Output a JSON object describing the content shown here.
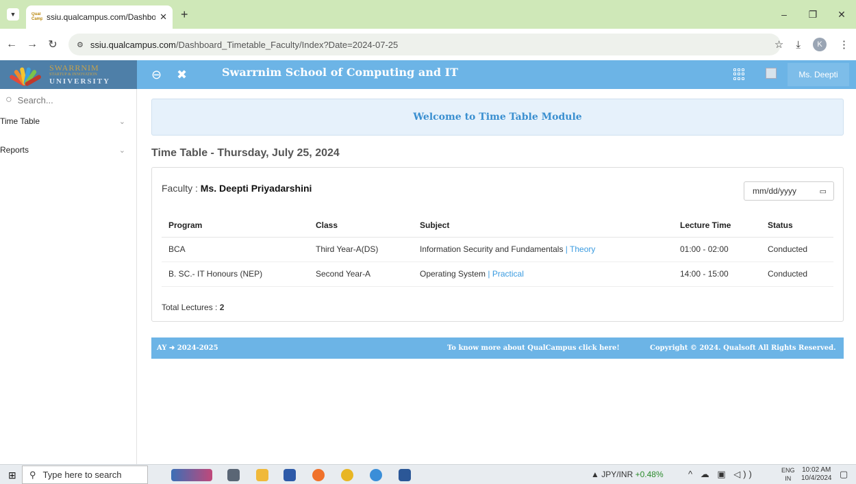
{
  "browser": {
    "tab_title": "ssiu.qualcampus.com/Dashboar",
    "favicon_text": "Qual\nCampus",
    "url_domain": "ssiu.qualcampus.com",
    "url_path": "/Dashboard_Timetable_Faculty/Index?Date=2024-07-25",
    "profile_initial": "K"
  },
  "header": {
    "logo_line1": "SWARRNIM",
    "logo_line2": "STARTUP & INNOVATION",
    "logo_line3": "UNIVERSITY",
    "title": "Swarrnim School of Computing and IT",
    "user_name": "Ms. Deepti"
  },
  "sidebar": {
    "search_placeholder": "Search...",
    "items": [
      {
        "label": "Time Table"
      },
      {
        "label": "Reports"
      }
    ]
  },
  "main": {
    "welcome": "Welcome to Time Table Module",
    "heading": "Time Table - Thursday, July 25, 2024",
    "faculty_label": "Faculty : ",
    "faculty_name": "Ms. Deepti Priyadarshini",
    "date_placeholder": "mm/dd/yyyy",
    "columns": [
      "Program",
      "Class",
      "Subject",
      "Lecture Time",
      "Status"
    ],
    "rows": [
      {
        "program": "BCA",
        "class": "Third Year-A(DS)",
        "subject": "Information Security and Fundamentals",
        "subject_type": "| Theory",
        "time": "01:00 - 02:00",
        "status": "Conducted"
      },
      {
        "program": "B. SC.- IT Honours (NEP)",
        "class": "Second Year-A",
        "subject": "Operating System",
        "subject_type": "| Practical",
        "time": "14:00 - 15:00",
        "status": "Conducted"
      }
    ],
    "total_label": "Total Lectures : ",
    "total_value": "2"
  },
  "footer": {
    "ay": "AY ➜ 2024-2025",
    "more": "To know more about QualCampus click here!",
    "copyright": "Copyright © 2024. Qualsoft All Rights Reserved."
  },
  "taskbar": {
    "search_placeholder": "Type here to search",
    "ticker_name": "JPY/INR",
    "ticker_change": "+0.48%",
    "lang1": "ENG",
    "lang2": "IN",
    "time": "10:02 AM",
    "date": "10/4/2024"
  },
  "colors": {
    "header_blue": "#6cb4e6",
    "welcome_bg": "#e6f1fb",
    "link_blue": "#3a9be0",
    "tabbar_green": "#cfe8b8"
  }
}
